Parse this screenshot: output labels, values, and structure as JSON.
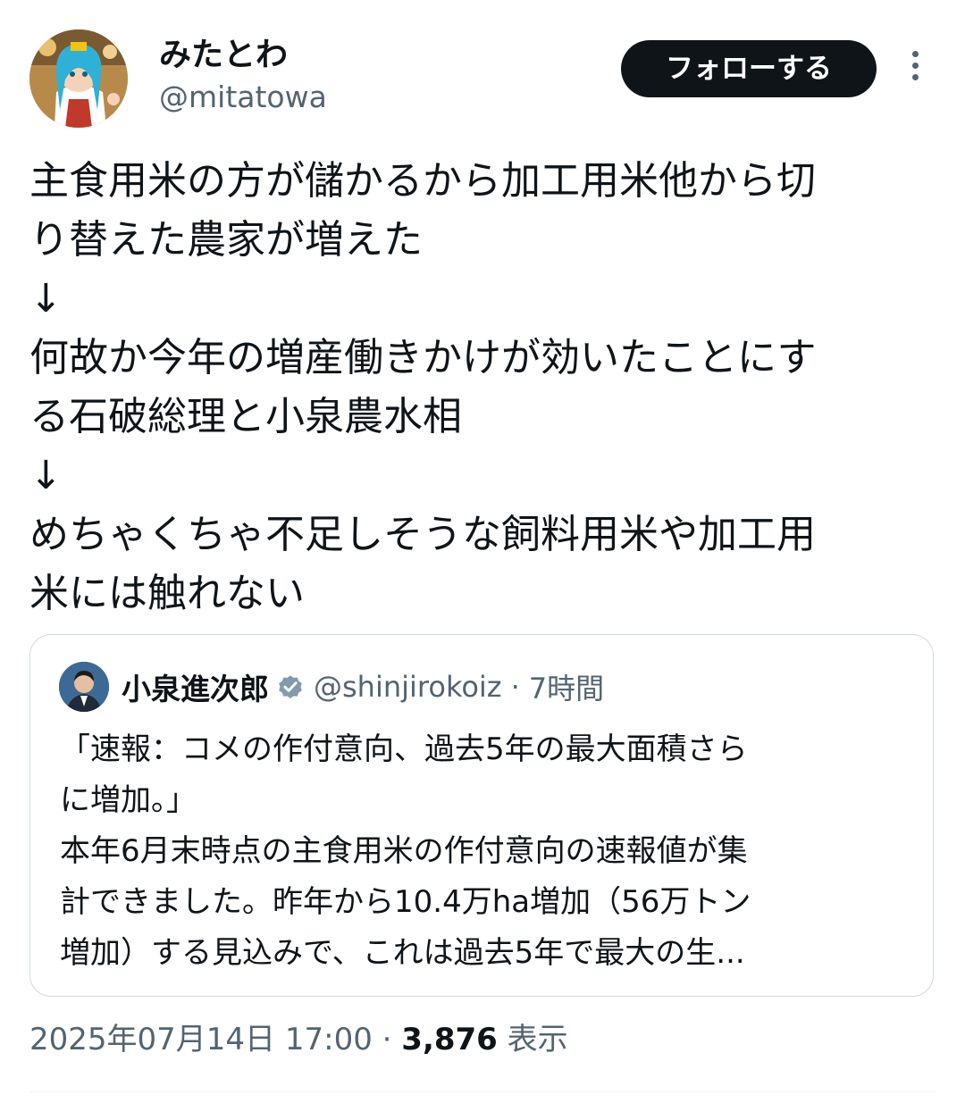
{
  "author": {
    "display_name": "みたとわ",
    "handle": "@mitatowa",
    "avatar_icon": "user-avatar"
  },
  "follow_label": "フォローする",
  "more_icon": "more-vertical-icon",
  "tweet": {
    "lines": [
      "主食用米の方が儲かるから加工用米他から切",
      "り替えた農家が増えた",
      "↓",
      "何故か今年の増産働きかけが効いたことにす",
      "る石破総理と小泉農水相",
      "↓",
      "めちゃくちゃ不足しそうな飼料用米や加工用",
      "米には触れない"
    ]
  },
  "quote": {
    "display_name": "小泉進次郎",
    "verified_icon": "verified-badge-icon",
    "verified_color": "#829aab",
    "handle": "@shinjirokoiz",
    "separator": "·",
    "time": "7時間",
    "lines": [
      "「速報：コメの作付意向、過去5年の最大面積さら",
      "に増加。」",
      "本年6月末時点の主食用米の作付意向の速報値が集",
      "計できました。昨年から10.4万ha増加（56万トン",
      "増加）する見込みで、これは過去5年で最大の生..."
    ]
  },
  "meta": {
    "timestamp": "2025年07月14日 17:00",
    "separator": "·",
    "views_count": "3,876",
    "views_label": "表示"
  },
  "colors": {
    "text": "#0f1419",
    "secondary": "#536471",
    "border": "#cfd9de",
    "button_bg": "#0f1419",
    "button_text": "#ffffff"
  }
}
